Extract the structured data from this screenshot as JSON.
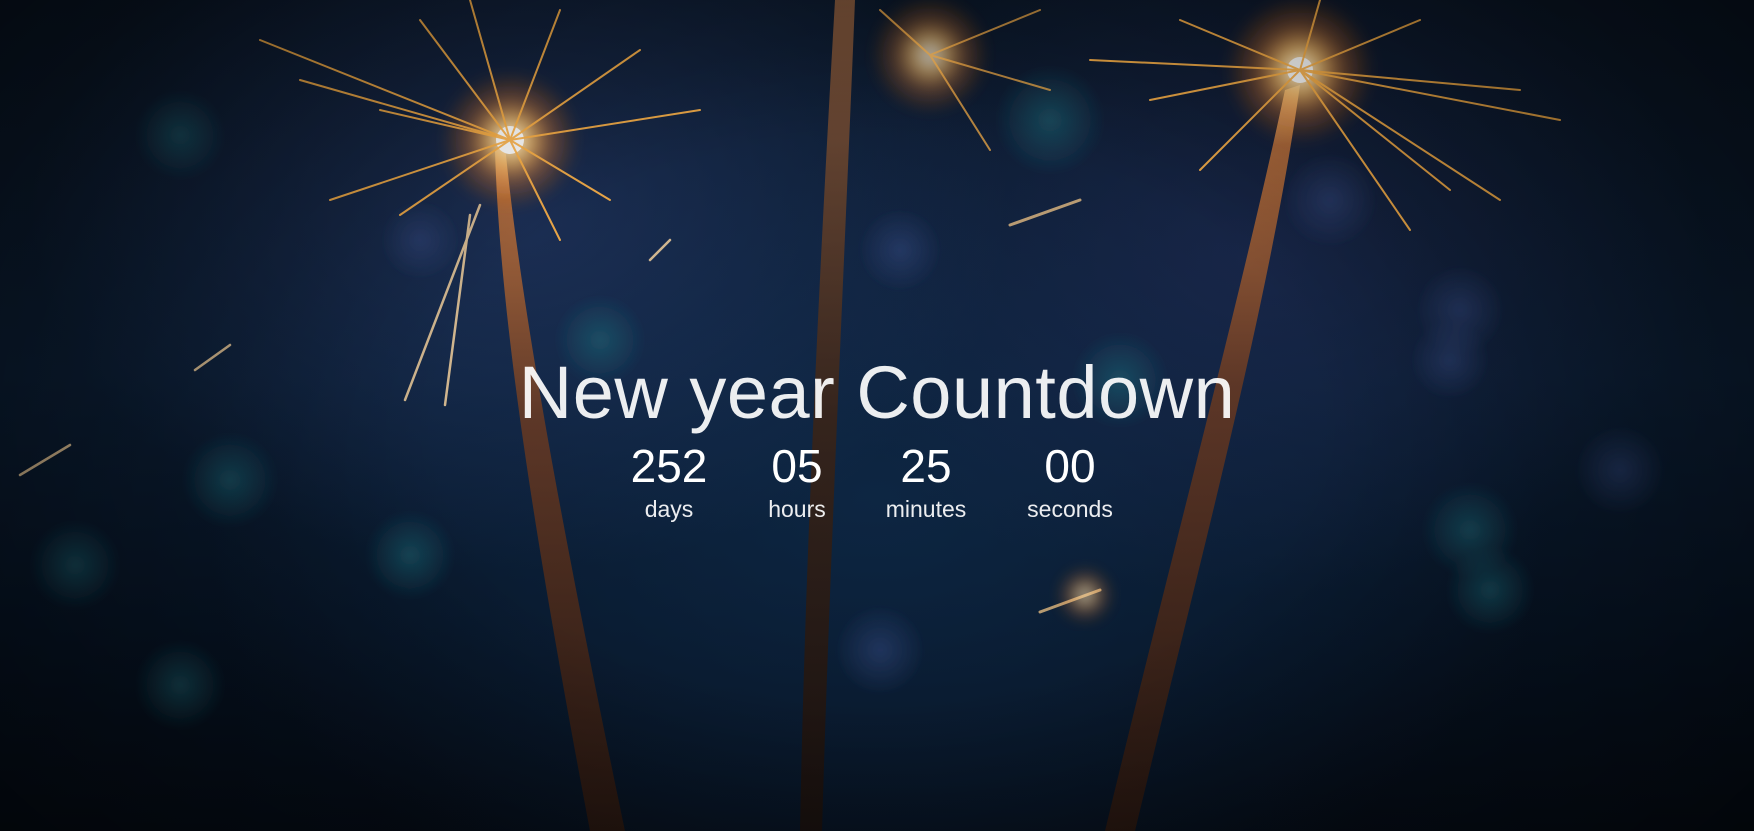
{
  "page": {
    "title": "New year Countdown"
  },
  "countdown": {
    "days": {
      "value": "252",
      "label": "days"
    },
    "hours": {
      "value": "05",
      "label": "hours"
    },
    "minutes": {
      "value": "25",
      "label": "minutes"
    },
    "seconds": {
      "value": "00",
      "label": "seconds"
    }
  },
  "colors": {
    "text": "#ffffff",
    "background_dark": "#07101c",
    "spark_orange": "#ffb347"
  },
  "background_image": {
    "icon": "sparklers-photo"
  }
}
